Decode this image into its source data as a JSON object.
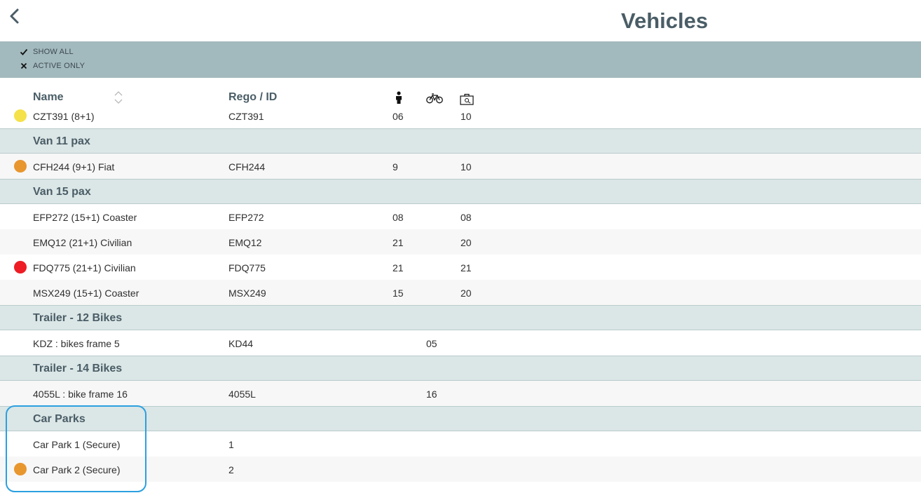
{
  "header": {
    "title": "Vehicles"
  },
  "filters": {
    "show_all": "SHOW ALL",
    "active_only": "ACTIVE ONLY"
  },
  "columns": {
    "name": "Name",
    "rego": "Rego / ID",
    "pax_icon": "person-icon",
    "bike_icon": "bicycle-icon",
    "luggage_icon": "luggage-icon"
  },
  "colors": {
    "yellow": "#f5e14a",
    "orange": "#e8962e",
    "red": "#ee1c24",
    "accent": "#2ba0e0"
  },
  "rows": [
    {
      "name": "CZT391 (8+1)",
      "rego": "CZT391",
      "pax": "06",
      "bikes": "",
      "luggage": "10",
      "status": "yellow"
    },
    {
      "group": "Van 11 pax"
    },
    {
      "name": "CFH244 (9+1) Fiat",
      "rego": "CFH244",
      "pax": "9",
      "bikes": "",
      "luggage": "10",
      "status": "orange"
    },
    {
      "group": "Van 15 pax"
    },
    {
      "name": "EFP272 (15+1) Coaster",
      "rego": "EFP272",
      "pax": "08",
      "bikes": "",
      "luggage": "08",
      "status": ""
    },
    {
      "name": "EMQ12 (21+1) Civilian",
      "rego": "EMQ12",
      "pax": "21",
      "bikes": "",
      "luggage": "20",
      "status": ""
    },
    {
      "name": "FDQ775 (21+1) Civilian",
      "rego": "FDQ775",
      "pax": "21",
      "bikes": "",
      "luggage": "21",
      "status": "red"
    },
    {
      "name": "MSX249 (15+1) Coaster",
      "rego": "MSX249",
      "pax": "15",
      "bikes": "",
      "luggage": "20",
      "status": ""
    },
    {
      "group": "Trailer - 12 Bikes"
    },
    {
      "name": "KDZ : bikes frame 5",
      "rego": "KD44",
      "pax": "",
      "bikes": "05",
      "luggage": "",
      "status": ""
    },
    {
      "group": "Trailer - 14 Bikes"
    },
    {
      "name": "4055L : bike frame 16",
      "rego": "4055L",
      "pax": "",
      "bikes": "16",
      "luggage": "",
      "status": ""
    },
    {
      "group": "Car Parks"
    },
    {
      "name": "Car Park 1 (Secure)",
      "rego": "1",
      "pax": "",
      "bikes": "",
      "luggage": "",
      "status": ""
    },
    {
      "name": "Car Park 2 (Secure)",
      "rego": "2",
      "pax": "",
      "bikes": "",
      "luggage": "",
      "status": "orange"
    }
  ]
}
